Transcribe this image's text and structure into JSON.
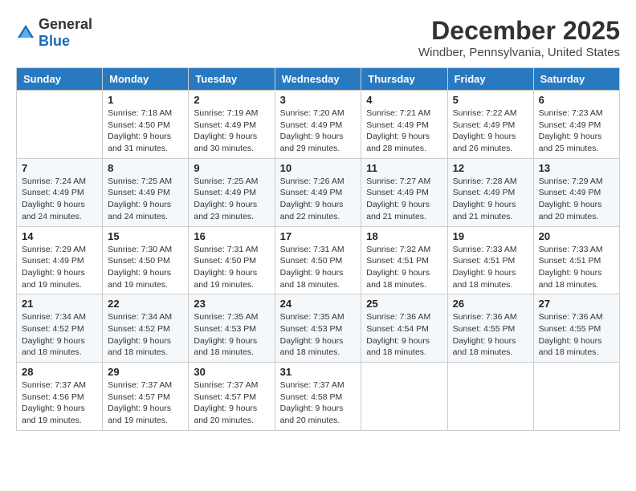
{
  "header": {
    "logo_general": "General",
    "logo_blue": "Blue",
    "month_title": "December 2025",
    "location": "Windber, Pennsylvania, United States"
  },
  "weekdays": [
    "Sunday",
    "Monday",
    "Tuesday",
    "Wednesday",
    "Thursday",
    "Friday",
    "Saturday"
  ],
  "weeks": [
    [
      {
        "day": "",
        "sunrise": "",
        "sunset": "",
        "daylight": ""
      },
      {
        "day": "1",
        "sunrise": "Sunrise: 7:18 AM",
        "sunset": "Sunset: 4:50 PM",
        "daylight": "Daylight: 9 hours and 31 minutes."
      },
      {
        "day": "2",
        "sunrise": "Sunrise: 7:19 AM",
        "sunset": "Sunset: 4:49 PM",
        "daylight": "Daylight: 9 hours and 30 minutes."
      },
      {
        "day": "3",
        "sunrise": "Sunrise: 7:20 AM",
        "sunset": "Sunset: 4:49 PM",
        "daylight": "Daylight: 9 hours and 29 minutes."
      },
      {
        "day": "4",
        "sunrise": "Sunrise: 7:21 AM",
        "sunset": "Sunset: 4:49 PM",
        "daylight": "Daylight: 9 hours and 28 minutes."
      },
      {
        "day": "5",
        "sunrise": "Sunrise: 7:22 AM",
        "sunset": "Sunset: 4:49 PM",
        "daylight": "Daylight: 9 hours and 26 minutes."
      },
      {
        "day": "6",
        "sunrise": "Sunrise: 7:23 AM",
        "sunset": "Sunset: 4:49 PM",
        "daylight": "Daylight: 9 hours and 25 minutes."
      }
    ],
    [
      {
        "day": "7",
        "sunrise": "Sunrise: 7:24 AM",
        "sunset": "Sunset: 4:49 PM",
        "daylight": "Daylight: 9 hours and 24 minutes."
      },
      {
        "day": "8",
        "sunrise": "Sunrise: 7:25 AM",
        "sunset": "Sunset: 4:49 PM",
        "daylight": "Daylight: 9 hours and 24 minutes."
      },
      {
        "day": "9",
        "sunrise": "Sunrise: 7:25 AM",
        "sunset": "Sunset: 4:49 PM",
        "daylight": "Daylight: 9 hours and 23 minutes."
      },
      {
        "day": "10",
        "sunrise": "Sunrise: 7:26 AM",
        "sunset": "Sunset: 4:49 PM",
        "daylight": "Daylight: 9 hours and 22 minutes."
      },
      {
        "day": "11",
        "sunrise": "Sunrise: 7:27 AM",
        "sunset": "Sunset: 4:49 PM",
        "daylight": "Daylight: 9 hours and 21 minutes."
      },
      {
        "day": "12",
        "sunrise": "Sunrise: 7:28 AM",
        "sunset": "Sunset: 4:49 PM",
        "daylight": "Daylight: 9 hours and 21 minutes."
      },
      {
        "day": "13",
        "sunrise": "Sunrise: 7:29 AM",
        "sunset": "Sunset: 4:49 PM",
        "daylight": "Daylight: 9 hours and 20 minutes."
      }
    ],
    [
      {
        "day": "14",
        "sunrise": "Sunrise: 7:29 AM",
        "sunset": "Sunset: 4:49 PM",
        "daylight": "Daylight: 9 hours and 19 minutes."
      },
      {
        "day": "15",
        "sunrise": "Sunrise: 7:30 AM",
        "sunset": "Sunset: 4:50 PM",
        "daylight": "Daylight: 9 hours and 19 minutes."
      },
      {
        "day": "16",
        "sunrise": "Sunrise: 7:31 AM",
        "sunset": "Sunset: 4:50 PM",
        "daylight": "Daylight: 9 hours and 19 minutes."
      },
      {
        "day": "17",
        "sunrise": "Sunrise: 7:31 AM",
        "sunset": "Sunset: 4:50 PM",
        "daylight": "Daylight: 9 hours and 18 minutes."
      },
      {
        "day": "18",
        "sunrise": "Sunrise: 7:32 AM",
        "sunset": "Sunset: 4:51 PM",
        "daylight": "Daylight: 9 hours and 18 minutes."
      },
      {
        "day": "19",
        "sunrise": "Sunrise: 7:33 AM",
        "sunset": "Sunset: 4:51 PM",
        "daylight": "Daylight: 9 hours and 18 minutes."
      },
      {
        "day": "20",
        "sunrise": "Sunrise: 7:33 AM",
        "sunset": "Sunset: 4:51 PM",
        "daylight": "Daylight: 9 hours and 18 minutes."
      }
    ],
    [
      {
        "day": "21",
        "sunrise": "Sunrise: 7:34 AM",
        "sunset": "Sunset: 4:52 PM",
        "daylight": "Daylight: 9 hours and 18 minutes."
      },
      {
        "day": "22",
        "sunrise": "Sunrise: 7:34 AM",
        "sunset": "Sunset: 4:52 PM",
        "daylight": "Daylight: 9 hours and 18 minutes."
      },
      {
        "day": "23",
        "sunrise": "Sunrise: 7:35 AM",
        "sunset": "Sunset: 4:53 PM",
        "daylight": "Daylight: 9 hours and 18 minutes."
      },
      {
        "day": "24",
        "sunrise": "Sunrise: 7:35 AM",
        "sunset": "Sunset: 4:53 PM",
        "daylight": "Daylight: 9 hours and 18 minutes."
      },
      {
        "day": "25",
        "sunrise": "Sunrise: 7:36 AM",
        "sunset": "Sunset: 4:54 PM",
        "daylight": "Daylight: 9 hours and 18 minutes."
      },
      {
        "day": "26",
        "sunrise": "Sunrise: 7:36 AM",
        "sunset": "Sunset: 4:55 PM",
        "daylight": "Daylight: 9 hours and 18 minutes."
      },
      {
        "day": "27",
        "sunrise": "Sunrise: 7:36 AM",
        "sunset": "Sunset: 4:55 PM",
        "daylight": "Daylight: 9 hours and 18 minutes."
      }
    ],
    [
      {
        "day": "28",
        "sunrise": "Sunrise: 7:37 AM",
        "sunset": "Sunset: 4:56 PM",
        "daylight": "Daylight: 9 hours and 19 minutes."
      },
      {
        "day": "29",
        "sunrise": "Sunrise: 7:37 AM",
        "sunset": "Sunset: 4:57 PM",
        "daylight": "Daylight: 9 hours and 19 minutes."
      },
      {
        "day": "30",
        "sunrise": "Sunrise: 7:37 AM",
        "sunset": "Sunset: 4:57 PM",
        "daylight": "Daylight: 9 hours and 20 minutes."
      },
      {
        "day": "31",
        "sunrise": "Sunrise: 7:37 AM",
        "sunset": "Sunset: 4:58 PM",
        "daylight": "Daylight: 9 hours and 20 minutes."
      },
      {
        "day": "",
        "sunrise": "",
        "sunset": "",
        "daylight": ""
      },
      {
        "day": "",
        "sunrise": "",
        "sunset": "",
        "daylight": ""
      },
      {
        "day": "",
        "sunrise": "",
        "sunset": "",
        "daylight": ""
      }
    ]
  ]
}
